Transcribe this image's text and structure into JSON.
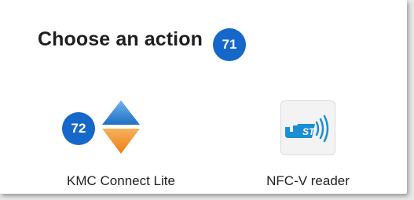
{
  "dialog": {
    "title": "Choose an action",
    "markers": [
      {
        "label": "71"
      },
      {
        "label": "72"
      }
    ],
    "apps": [
      {
        "label": "KMC Connect Lite",
        "icon": "kmc-updown-arrows-icon"
      },
      {
        "label": "NFC-V reader",
        "icon": "nfc-reader-icon"
      }
    ]
  },
  "colors": {
    "marker": "#1568c9",
    "kmc_up": "#2e7fd1",
    "kmc_down": "#f08a24",
    "nfc_blue": "#1a8fd4"
  }
}
